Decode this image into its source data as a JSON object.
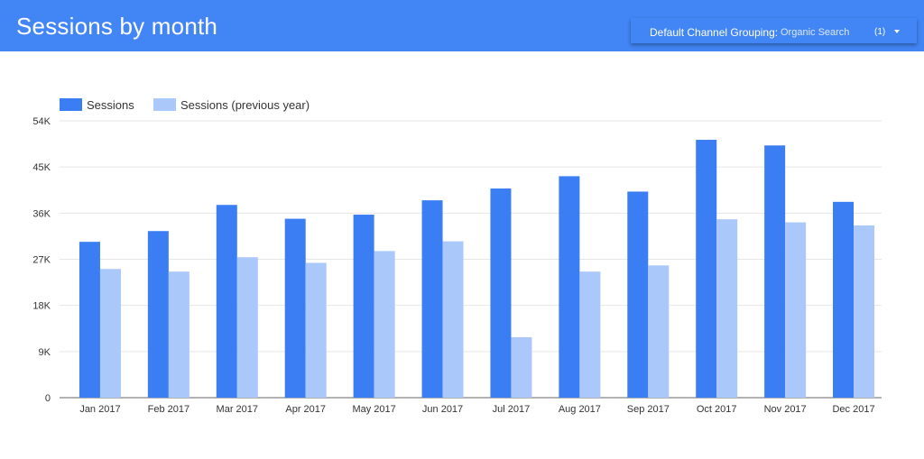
{
  "header": {
    "title": "Sessions by month",
    "filter": {
      "label": "Default Channel Grouping:",
      "value": "Organic Search",
      "count": "(1)"
    }
  },
  "colors": {
    "header_bg": "#4285f4",
    "series_current": "#3b7ef3",
    "series_previous": "#abc8fb"
  },
  "chart_data": {
    "type": "bar",
    "categories": [
      "Jan 2017",
      "Feb 2017",
      "Mar 2017",
      "Apr 2017",
      "May 2017",
      "Jun 2017",
      "Jul 2017",
      "Aug 2017",
      "Sep 2017",
      "Oct 2017",
      "Nov 2017",
      "Dec 2017"
    ],
    "series": [
      {
        "name": "Sessions",
        "values": [
          30400,
          32500,
          37600,
          34900,
          35700,
          38500,
          40800,
          43200,
          40200,
          50300,
          49200,
          38200
        ]
      },
      {
        "name": "Sessions (previous year)",
        "values": [
          25100,
          24600,
          27400,
          26300,
          28600,
          30500,
          11800,
          24600,
          25800,
          34800,
          34200,
          33600
        ]
      }
    ],
    "yticks": [
      "0",
      "9K",
      "18K",
      "27K",
      "36K",
      "45K",
      "54K"
    ],
    "ytick_values": [
      0,
      9000,
      18000,
      27000,
      36000,
      45000,
      54000
    ],
    "ylim": [
      0,
      54000
    ],
    "grid": true,
    "legend_position": "top-left"
  }
}
